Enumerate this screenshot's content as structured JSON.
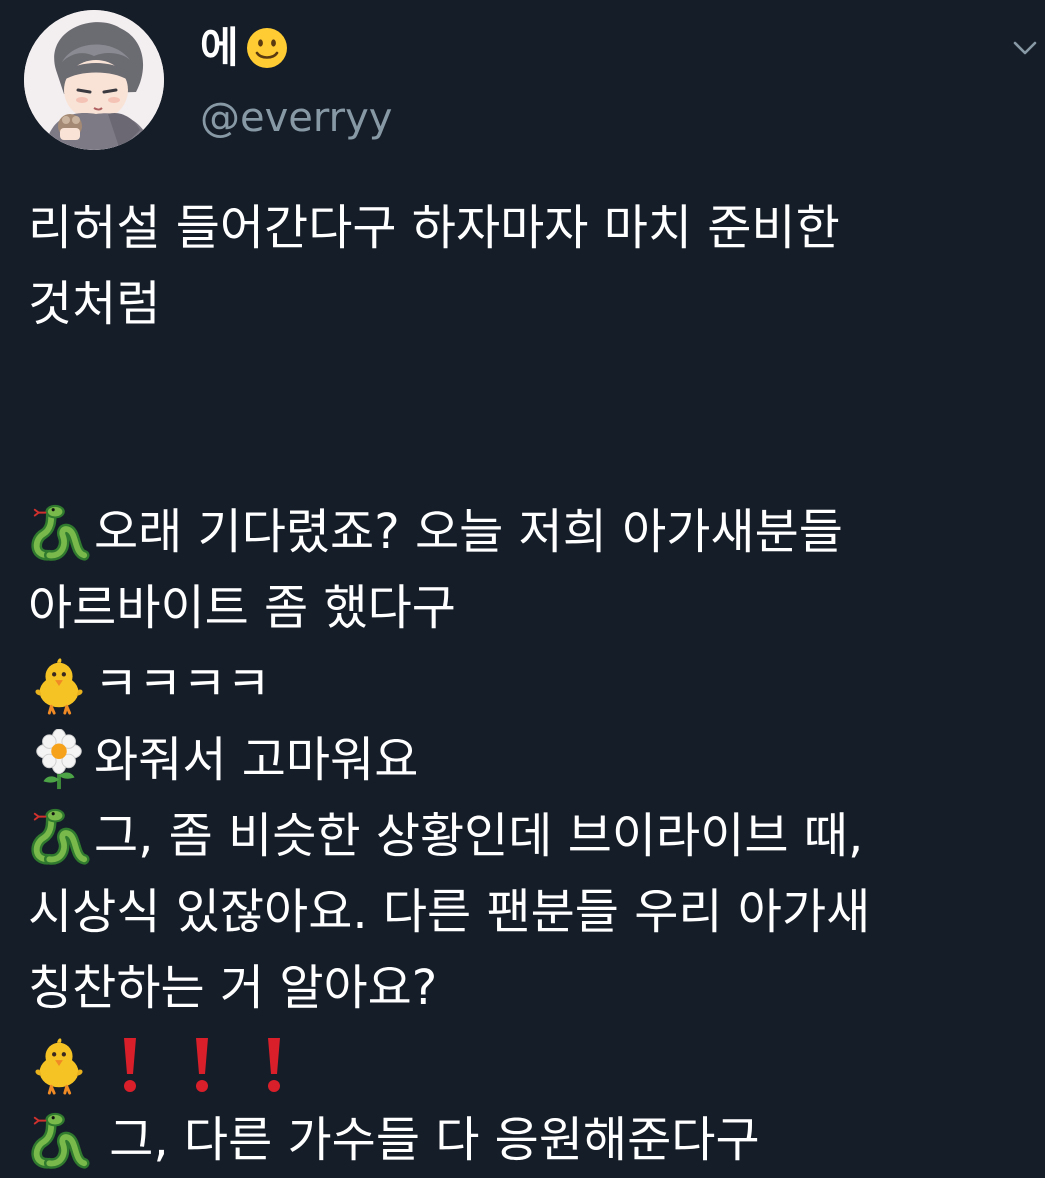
{
  "user": {
    "display_name": "에",
    "display_name_emoji": "slightly-smiling-face",
    "handle": "@everryy",
    "avatar": "anime-boy-illustration"
  },
  "menu": {
    "icon": "chevron-down-icon"
  },
  "tweet": {
    "lines": [
      "리허설 들어간다구 하자마자 마치 준비한",
      "것처럼",
      "",
      "오래 기다렸죠? 오늘 저희 아가새분들",
      "아르바이트 좀 했다구",
      "ㅋㅋㅋㅋ",
      "와줘서 고마워요",
      "그, 좀 비슷한 상황인데 브이라이브 때,",
      "시상식 있잖아요. 다른 팬분들 우리 아가새",
      "칭찬하는 거 알아요?",
      "",
      " 그, 다른 가수들 다 응원해준다구"
    ],
    "line_emojis": {
      "3": "snake",
      "5": "baby-chick",
      "6": "blossom",
      "7": "snake",
      "10": "baby-chick + red-exclamation-mark x3",
      "11": "snake"
    }
  },
  "colors": {
    "background": "#151d28",
    "text": "#ffffff",
    "secondary_text": "#8899a6"
  }
}
